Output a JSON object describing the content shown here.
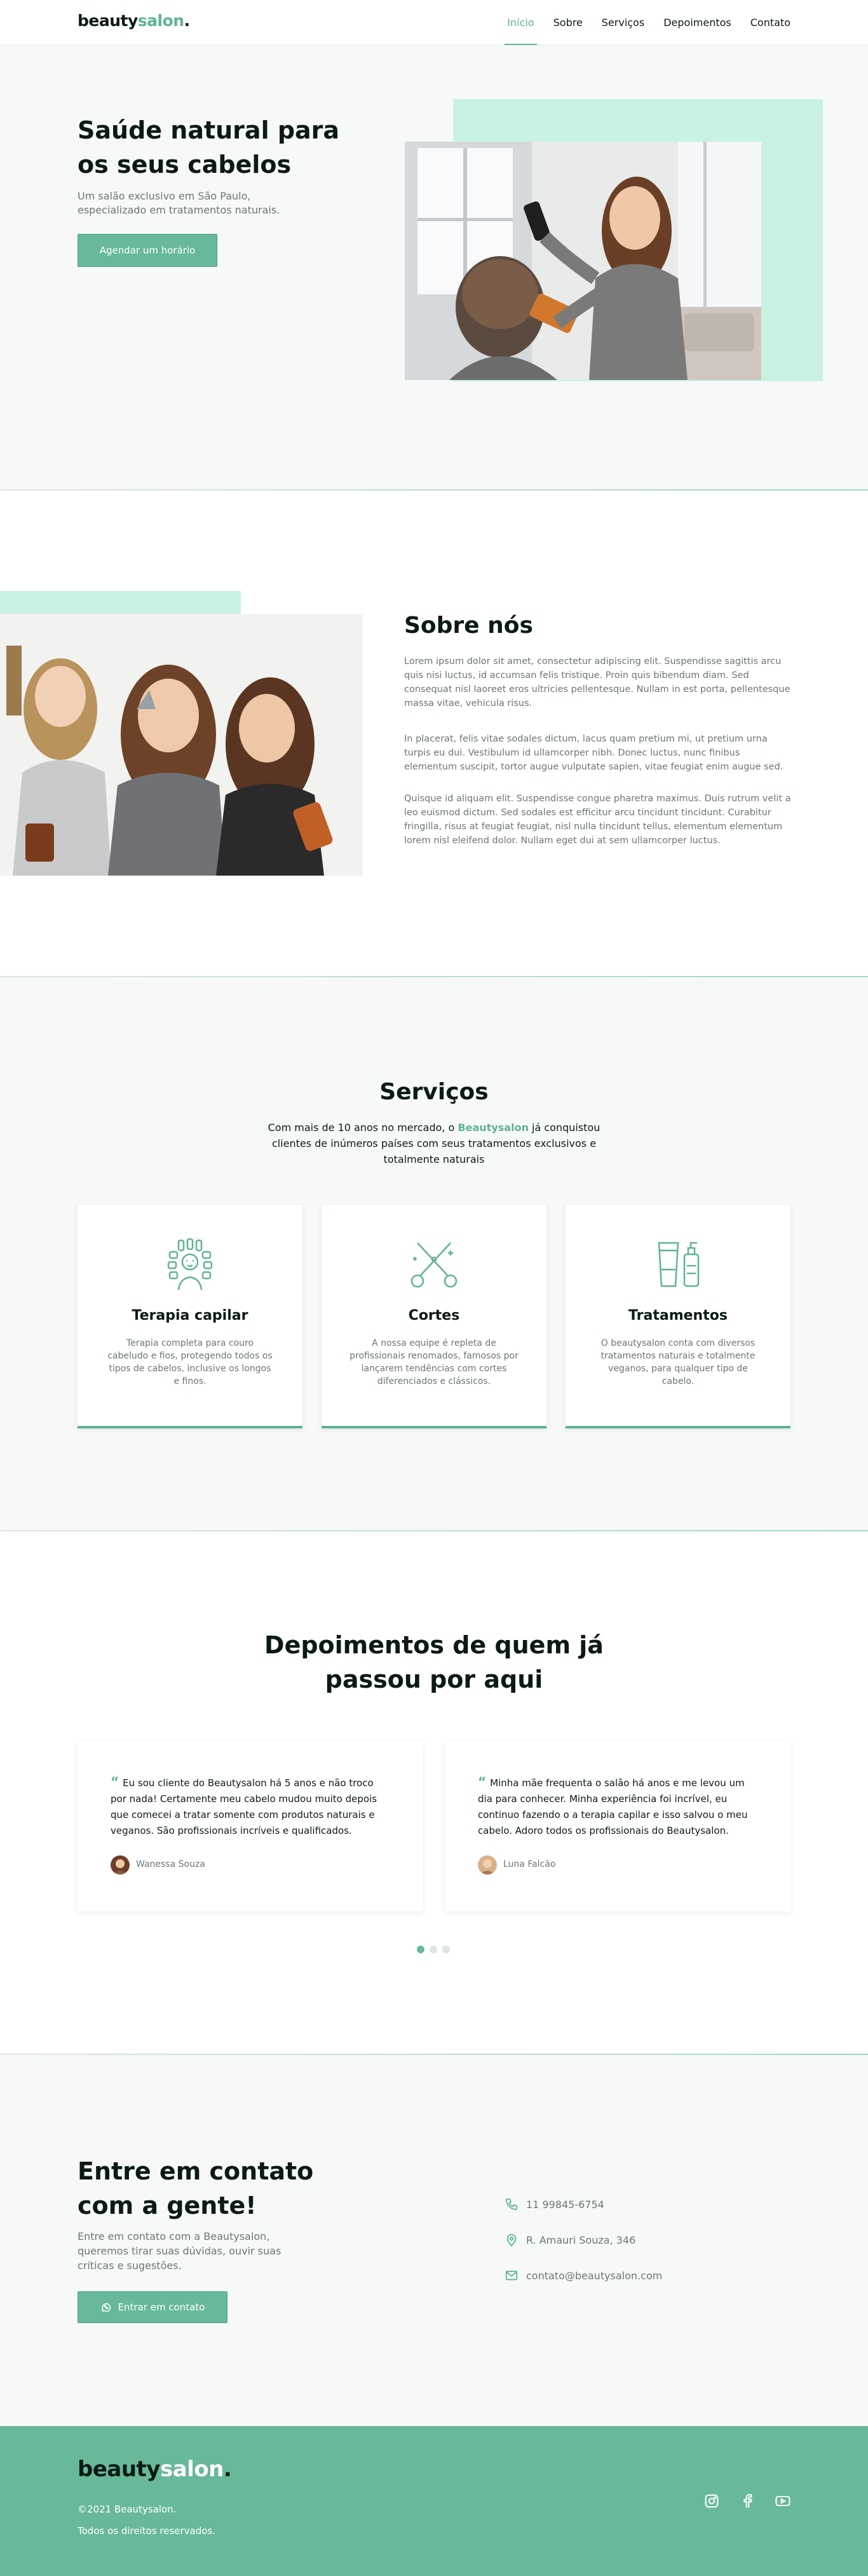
{
  "header": {
    "logo_main": "beauty",
    "logo_accent": "salon",
    "logo_dot": ".",
    "nav": [
      "Início",
      "Sobre",
      "Serviços",
      "Depoimentos",
      "Contato"
    ]
  },
  "hero": {
    "title": "Saúde natural para os seus cabelos",
    "subtitle": "Um salão exclusivo em São Paulo, especializado em tratamentos naturais.",
    "button": "Agendar um  horário"
  },
  "about": {
    "title": "Sobre nós",
    "paragraphs": [
      "Lorem ipsum dolor sit amet, consectetur adipiscing elit. Suspendisse sagittis arcu quis nisi luctus, id accumsan felis tristique. Proin quis bibendum diam. Sed consequat nisl laoreet eros ultricies pellentesque. Nullam in est porta, pellentesque massa vitae, vehicula risus.",
      "In placerat, felis vitae sodales dictum, lacus quam pretium mi, ut pretium urna turpis eu dui. Vestibulum id ullamcorper nibh. Donec luctus, nunc finibus elementum suscipit, tortor augue vulputate sapien, vitae feugiat enim augue sed.",
      "Quisque id aliquam elit. Suspendisse congue pharetra maximus. Duis rutrum velit a leo euismod dictum. Sed sodales est efficitur arcu tincidunt tincidunt. Curabitur fringilla, risus at feugiat feugiat, nisl nulla tincidunt tellus, elementum elementum lorem nisl eleifend dolor. Nullam eget dui at sem ullamcorper luctus."
    ]
  },
  "services": {
    "title": "Serviços",
    "intro_before": "Com mais de 10 anos no mercado, o ",
    "intro_brand": "Beautysalon",
    "intro_after": " já conquistou clientes de inúmeros países com seus tratamentos exclusivos e totalmente naturais",
    "cards": [
      {
        "icon": "hair-curlers-icon",
        "title": "Terapia capilar",
        "desc": "Terapia completa para couro cabeludo e fios, protegendo todos os tipos de cabelos, inclusive os longos e finos."
      },
      {
        "icon": "scissors-icon",
        "title": "Cortes",
        "desc": "A nossa equipe é repleta de profissionais renomados, famosos por lançarem tendências com cortes diferenciados e clássicos."
      },
      {
        "icon": "cosmetic-bottles-icon",
        "title": "Tratamentos",
        "desc": "O beautysalon conta com diversos tratamentos naturais e totalmente veganos, para qualquer tipo de cabelo."
      }
    ]
  },
  "testimonials": {
    "title": "Depoimentos de quem já passou por aqui",
    "items": [
      {
        "quote": "Eu sou cliente do Beautysalon há 5 anos e não troco por nada! Certamente meu cabelo mudou muito depois que comecei a tratar somente com produtos naturais e veganos. São profissionais incríveis e qualificados.",
        "name": "Wanessa Souza"
      },
      {
        "quote": "Minha mãe frequenta o salão há anos e me levou um dia para conhecer. Minha experiência foi incrível, eu continuo fazendo o a terapia capilar e isso salvou o meu cabelo. Adoro todos os profissionais do Beautysalon.",
        "name": "Luna Falcão"
      }
    ],
    "active_page": 1,
    "pages": 3
  },
  "contact": {
    "title": "Entre em contato com a gente!",
    "subtitle": "Entre em contato com a Beautysalon, queremos tirar suas dúvidas, ouvir suas críticas e sugestões.",
    "button": "Entrar em contato",
    "phone": "11 99845-6754",
    "address": "R. Amauri Souza, 346",
    "email": "contato@beautysalon.com"
  },
  "footer": {
    "logo_main": "beauty",
    "logo_accent": "salon",
    "logo_dot": ".",
    "copyright": "©2021 Beautysalon.",
    "rights": "Todos os direitos reservados."
  },
  "colors": {
    "accent": "#67b99a",
    "mint": "#c9f2e3",
    "dark": "#0b1a15",
    "muted": "#6b7771"
  }
}
